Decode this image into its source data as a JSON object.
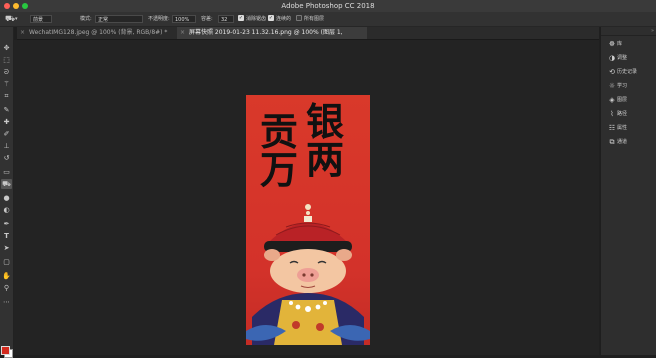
{
  "window": {
    "title": "Adobe Photoshop CC 2018"
  },
  "options_bar": {
    "tool_icon": "paint-bucket-icon",
    "fill_source": "前景",
    "mode_label": "模式:",
    "mode_value": "正常",
    "opacity_label": "不透明度:",
    "opacity_value": "100%",
    "tolerance_label": "容差:",
    "tolerance_value": "32",
    "anti_alias_label": "消除锯齿",
    "anti_alias_checked": true,
    "contiguous_label": "连续的",
    "contiguous_checked": true,
    "all_layers_label": "所有图层",
    "all_layers_checked": false
  },
  "tabs": [
    {
      "label": "WechatIMG128.jpeg @ 100% (背景, RGB/8#) *",
      "active": false
    },
    {
      "label": "屏幕快照 2019-01-23 11.32.16.png @ 100% (图层 1, RGB/8*)",
      "active": true
    }
  ],
  "tools": [
    "move-tool-icon",
    "marquee-tool-icon",
    "lasso-tool-icon",
    "magic-wand-icon",
    "crop-tool-icon",
    "eyedropper-icon",
    "healing-brush-icon",
    "brush-tool-icon",
    "clone-stamp-icon",
    "history-brush-icon",
    "eraser-icon",
    "paint-bucket-icon",
    "blur-tool-icon",
    "dodge-tool-icon",
    "pen-tool-icon",
    "type-tool-icon",
    "path-selection-icon",
    "rectangle-tool-icon",
    "hand-tool-icon",
    "zoom-tool-icon"
  ],
  "colors": {
    "foreground": "#d32a1e",
    "background": "#ffffff"
  },
  "document": {
    "calligraphy_left": "贡万",
    "calligraphy_right": "银两"
  },
  "panels": [
    {
      "icon": "color-wheel-icon",
      "label": "库"
    },
    {
      "icon": "adjustments-icon",
      "label": "调整"
    },
    {
      "icon": "history-icon",
      "label": "历史记录"
    },
    {
      "icon": "lightbulb-icon",
      "label": "学习"
    },
    {
      "icon": "layers-icon",
      "label": "图层"
    },
    {
      "icon": "paths-icon",
      "label": "路径"
    },
    {
      "icon": "properties-icon",
      "label": "属性"
    },
    {
      "icon": "channels-icon",
      "label": "通道"
    }
  ]
}
